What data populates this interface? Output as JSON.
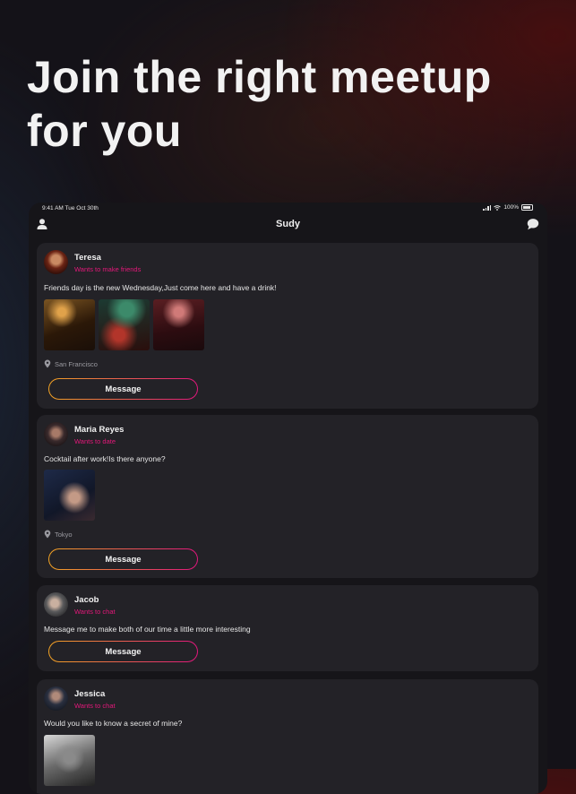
{
  "headline": {
    "line1": "Join the right meetup",
    "line2": "for you"
  },
  "status_bar": {
    "time": "9:41 AM  Tue Oct 30th",
    "battery": "100%"
  },
  "nav": {
    "title": "Sudy",
    "left_icon": "user-icon",
    "right_icon": "chat-bubble-icon"
  },
  "colors": {
    "accent_pink": "#e4187a",
    "button_gradient_start": "#f2a324",
    "button_gradient_end": "#e0167c",
    "card_bg": "#232227"
  },
  "posts": [
    {
      "name": "Teresa",
      "wants": "Wants to make friends",
      "text": "Friends day is the new Wednesday,Just come here and have a drink!",
      "photo_count": 3,
      "location": "San Francisco",
      "button": "Message"
    },
    {
      "name": "Maria Reyes",
      "wants": "Wants to date",
      "text": "Cocktail after work!Is there anyone?",
      "photo_count": 1,
      "location": "Tokyo",
      "button": "Message"
    },
    {
      "name": "Jacob",
      "wants": "Wants to chat",
      "text": "Message me to make both of our time a little more interesting",
      "photo_count": 0,
      "location": "",
      "button": "Message"
    },
    {
      "name": "Jessica",
      "wants": "Wants to chat",
      "text": "Would you like to know a secret of mine?",
      "photo_count": 1,
      "location": "",
      "button": ""
    }
  ]
}
